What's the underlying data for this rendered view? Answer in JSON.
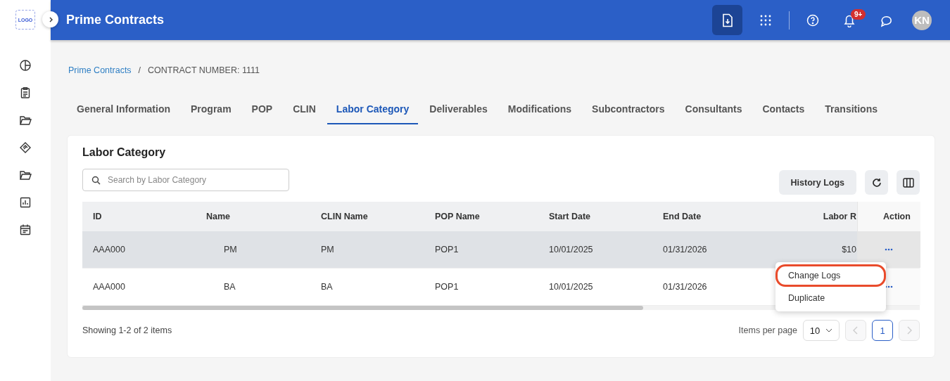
{
  "logo": "LOGO",
  "header": {
    "title": "Prime Contracts",
    "notification_count": "9+",
    "avatar": "KN"
  },
  "breadcrumb": {
    "link": "Prime Contracts",
    "separator": "/",
    "current": "CONTRACT NUMBER: 1111"
  },
  "tabs": [
    {
      "label": "General Information",
      "selected": false
    },
    {
      "label": "Program",
      "selected": false
    },
    {
      "label": "POP",
      "selected": false
    },
    {
      "label": "CLIN",
      "selected": false
    },
    {
      "label": "Labor Category",
      "selected": true
    },
    {
      "label": "Deliverables",
      "selected": false
    },
    {
      "label": "Modifications",
      "selected": false
    },
    {
      "label": "Subcontractors",
      "selected": false
    },
    {
      "label": "Consultants",
      "selected": false
    },
    {
      "label": "Contacts",
      "selected": false
    },
    {
      "label": "Transitions",
      "selected": false
    }
  ],
  "card": {
    "title": "Labor Category",
    "search": {
      "placeholder": "Search by Labor Category"
    },
    "history_button": "History Logs"
  },
  "table": {
    "columns": [
      "ID",
      "Name",
      "CLIN Name",
      "POP Name",
      "Start Date",
      "End Date",
      "Labor R"
    ],
    "action_column": "Action",
    "rows": [
      {
        "cells": [
          "AAA000",
          "PM",
          "PM",
          "POP1",
          "10/01/2025",
          "01/31/2026",
          "$10"
        ],
        "selected": true
      },
      {
        "cells": [
          "AAA000",
          "BA",
          "BA",
          "POP1",
          "10/01/2025",
          "01/31/2026",
          ""
        ],
        "selected": false
      }
    ]
  },
  "action_menu": [
    {
      "label": "Change Logs",
      "circled": true
    },
    {
      "label": "Duplicate",
      "circled": false
    }
  ],
  "footer": {
    "summary": "Showing 1-2 of 2 items",
    "per_page_label": "Items per page",
    "per_page": "10",
    "page": "1"
  }
}
